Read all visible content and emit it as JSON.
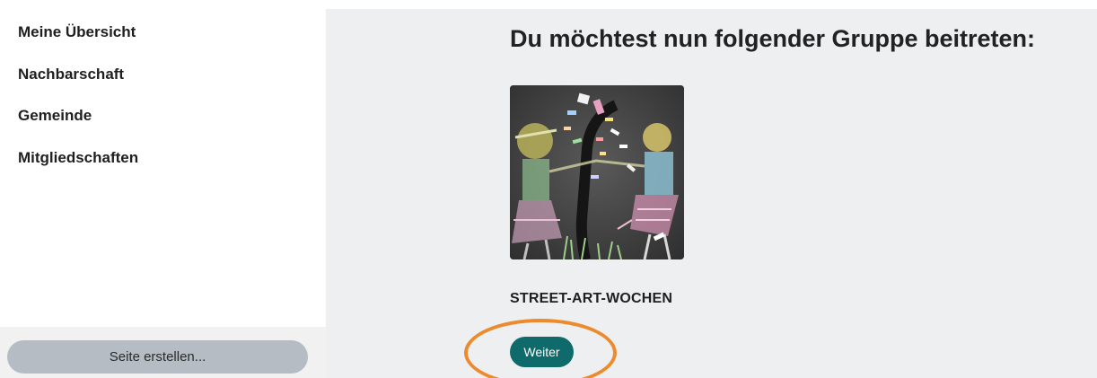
{
  "sidebar": {
    "items": [
      {
        "label": "Meine Übersicht"
      },
      {
        "label": "Nachbarschaft"
      },
      {
        "label": "Gemeinde"
      },
      {
        "label": "Mitgliedschaften"
      }
    ],
    "create_page_label": "Seite erstellen..."
  },
  "main": {
    "title": "Du möchtest nun folgender Gruppe beitreten:",
    "group": {
      "name": "STREET-ART-WOCHEN",
      "image_alt": "Kreidezeichnung auf Asphalt"
    },
    "continue_label": "Weiter"
  },
  "colors": {
    "continue_button": "#0f6b6b",
    "highlight": "#ec8a2e",
    "main_background": "#eeeff1",
    "create_button": "#b6bcc3"
  }
}
